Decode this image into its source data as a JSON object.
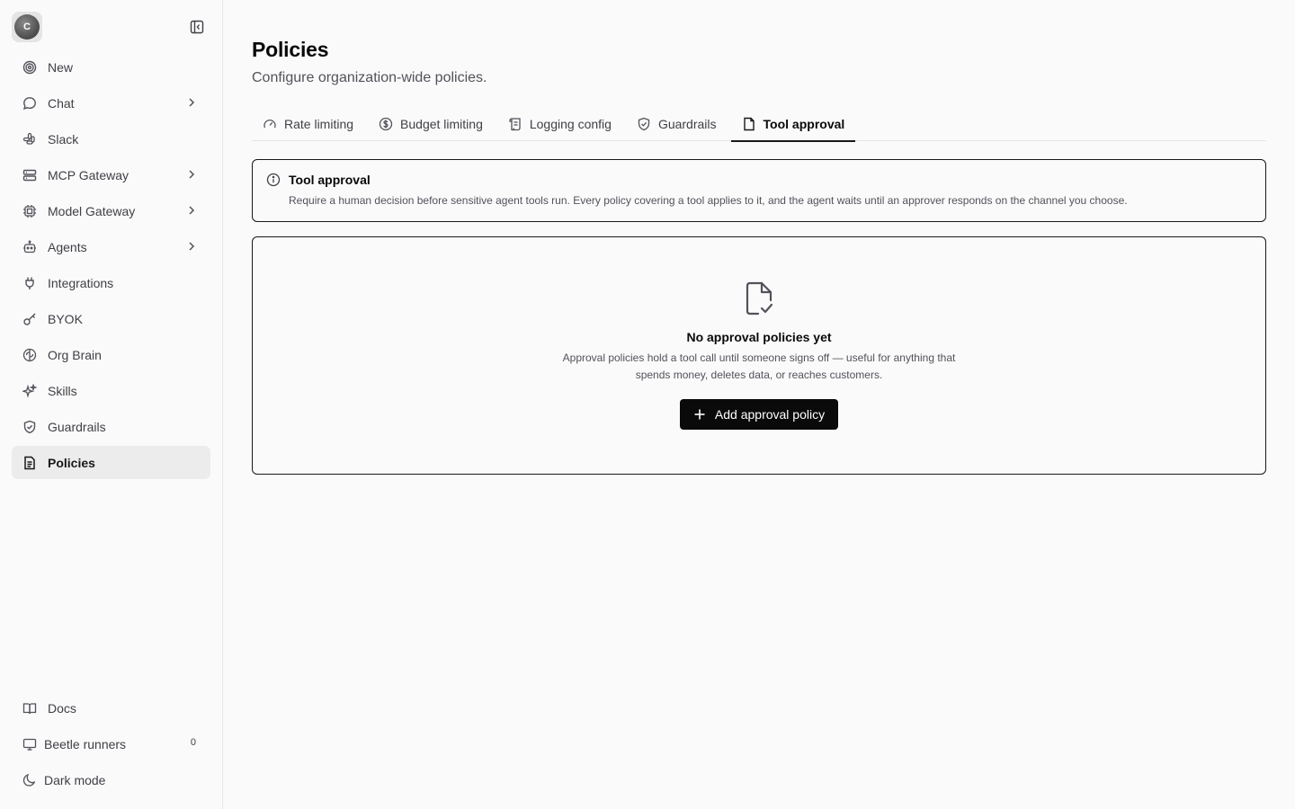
{
  "sidebar": {
    "avatar_initial": "C",
    "items": [
      {
        "label": "New",
        "icon": "target-icon"
      },
      {
        "label": "Chat",
        "icon": "chat-bubble-icon"
      },
      {
        "label": "Slack",
        "icon": "slack-icon"
      },
      {
        "label": "MCP Gateway",
        "icon": "server-icon"
      },
      {
        "label": "Model Gateway",
        "icon": "cpu-icon"
      },
      {
        "label": "Agents",
        "icon": "bot-icon"
      },
      {
        "label": "Integrations",
        "icon": "plug-icon"
      },
      {
        "label": "BYOK",
        "icon": "key-icon"
      },
      {
        "label": "Org Brain",
        "icon": "brain-icon"
      },
      {
        "label": "Skills",
        "icon": "sparkles-icon"
      },
      {
        "label": "Guardrails",
        "icon": "shield-check-icon"
      },
      {
        "label": "Policies",
        "icon": "file-text-icon",
        "active": true
      }
    ],
    "bottom": [
      {
        "label": "Docs",
        "icon": "book-open-icon"
      },
      {
        "label": "Beetle runners",
        "icon": "monitor-icon",
        "count": "0"
      },
      {
        "label": "Dark mode",
        "icon": "moon-icon"
      }
    ]
  },
  "page": {
    "title": "Policies",
    "subtitle": "Configure organization-wide policies."
  },
  "tabs": [
    {
      "label": "Rate limiting",
      "icon": "gauge-icon"
    },
    {
      "label": "Budget limiting",
      "icon": "dollar-circle-icon"
    },
    {
      "label": "Logging config",
      "icon": "scroll-icon"
    },
    {
      "label": "Guardrails",
      "icon": "shield-check-icon"
    },
    {
      "label": "Tool approval",
      "icon": "file-check-icon",
      "active": true
    }
  ],
  "info": {
    "title": "Tool approval",
    "text": "Require a human decision before sensitive agent tools run. Every policy covering a tool applies to it, and the agent waits until an approver responds on the channel you choose."
  },
  "empty": {
    "title": "No approval policies yet",
    "text": "Approval policies hold a tool call until someone signs off — useful for anything that spends money, deletes data, or reaches customers.",
    "button_label": "Add approval policy"
  }
}
